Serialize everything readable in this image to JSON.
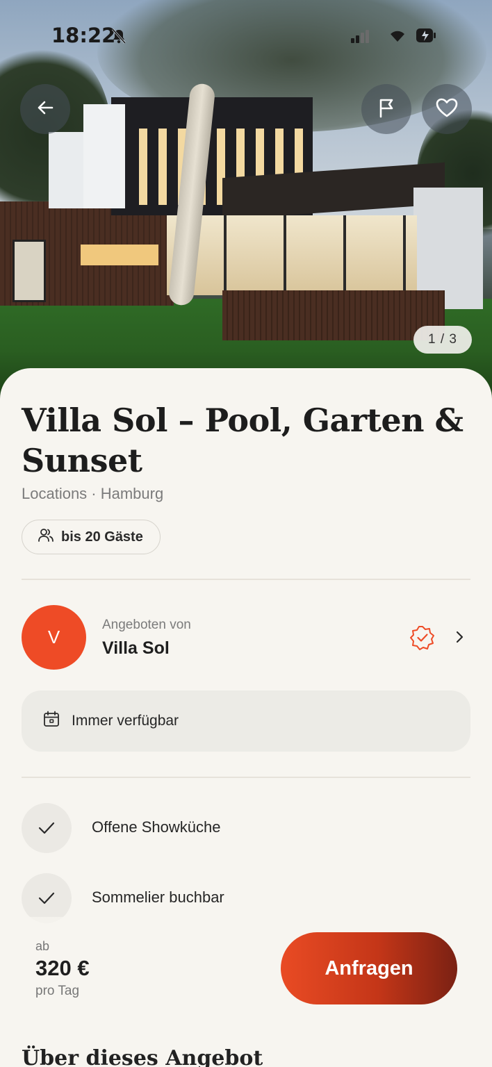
{
  "status_bar": {
    "time": "18:22"
  },
  "gallery": {
    "counter": "1 / 3"
  },
  "listing": {
    "title": "Villa Sol – Pool, Garten & Sunset",
    "subtitle": "Locations · Hamburg",
    "guests": "bis 20 Gäste"
  },
  "host": {
    "label": "Angeboten von",
    "name": "Villa Sol",
    "initial": "V"
  },
  "availability": "Immer verfügbar",
  "features": [
    {
      "label": "Offene Showküche"
    },
    {
      "label": "Sommelier buchbar"
    }
  ],
  "about_title": "Über dieses Angebot",
  "pricing": {
    "prefix": "ab",
    "price": "320 €",
    "unit": "pro Tag"
  },
  "cta_label": "Anfragen",
  "colors": {
    "accent": "#ee4b26",
    "background": "#f7f5f0"
  }
}
